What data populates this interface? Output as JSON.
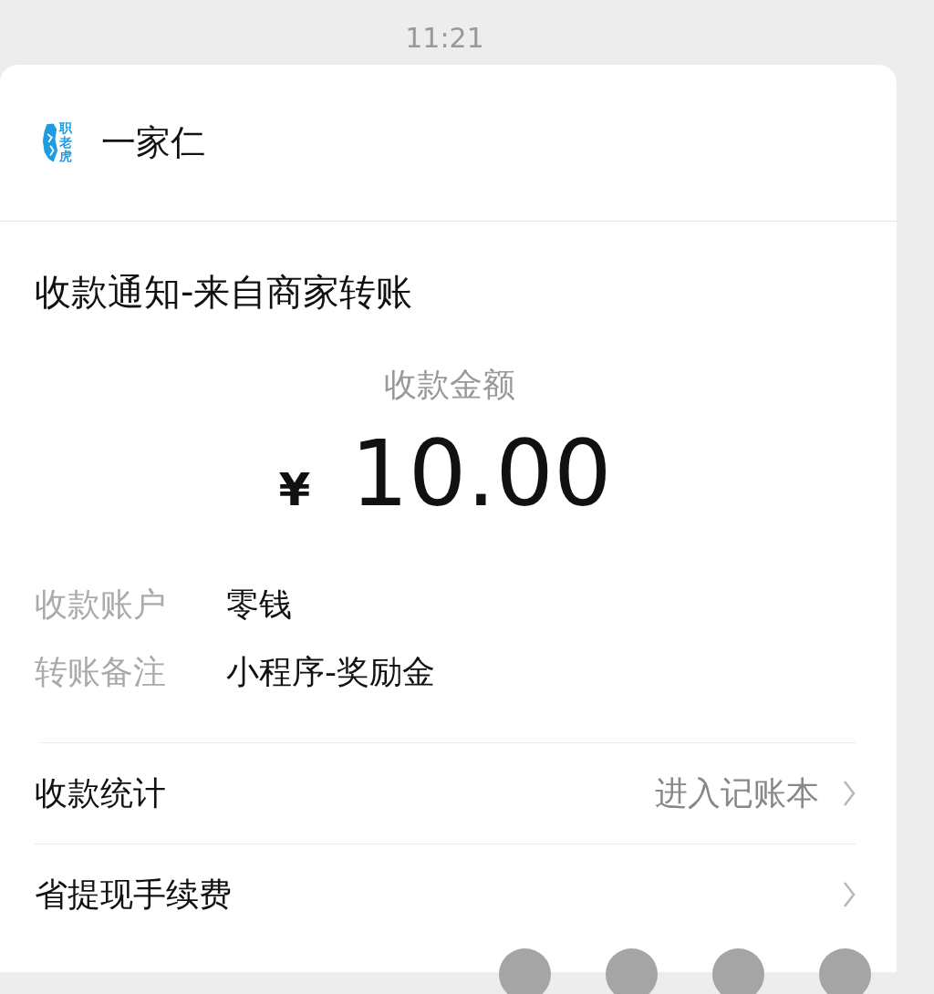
{
  "time": "11:21",
  "sender": {
    "logo_text": "职老虎",
    "name": "一家仁"
  },
  "notice": {
    "title": "收款通知-来自商家转账",
    "amount_label": "收款金额",
    "currency": "¥",
    "amount": "10.00",
    "details": [
      {
        "label": "收款账户",
        "value": "零钱"
      },
      {
        "label": "转账备注",
        "value": "小程序-奖励金"
      }
    ]
  },
  "links": [
    {
      "label": "收款统计",
      "action": "进入记账本"
    },
    {
      "label": "省提现手续费"
    }
  ],
  "avatars": [
    {
      "kind": "avatar"
    },
    {
      "kind": "avatar"
    },
    {
      "kind": "avatar"
    },
    {
      "kind": "avatar"
    }
  ]
}
